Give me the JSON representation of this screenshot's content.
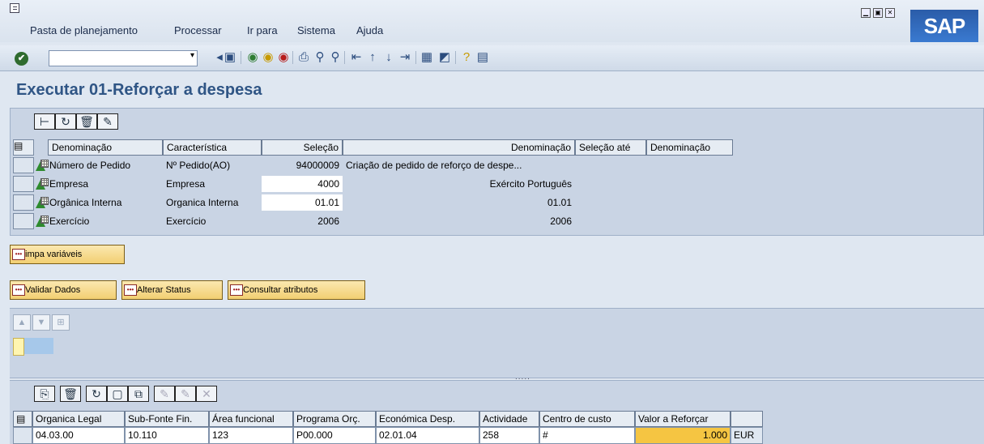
{
  "menubar": {
    "items": [
      "Pasta de planejamento",
      "Processar",
      "Ir para",
      "Sistema",
      "Ajuda"
    ],
    "logo": "SAP"
  },
  "toolbar": {
    "command_field_value": "",
    "icons": [
      "ok-icon",
      "save-icon",
      "back-icon",
      "exit-icon",
      "cancel-icon",
      "print-icon",
      "find-icon",
      "find-next-icon",
      "first-page-icon",
      "previous-page-icon",
      "next-page-icon",
      "last-page-icon",
      "create-session-icon",
      "shortcut-icon",
      "help-icon",
      "layout-icon"
    ]
  },
  "page": {
    "title": "Executar 01-Reforçar a despesa"
  },
  "grid1": {
    "headers": [
      "Denominação",
      "Característica",
      "Seleção",
      "Denominação",
      "Seleção até",
      "Denominação"
    ],
    "rows": [
      {
        "denominacao": "Número de Pedido",
        "caracteristica": "Nº Pedido(AO)",
        "selecao": "94000009",
        "denominacao2": "Criação de pedido de reforço de despe..."
      },
      {
        "denominacao": "Empresa",
        "caracteristica": "Empresa",
        "selecao": "4000",
        "denominacao2": "Exército Português"
      },
      {
        "denominacao": "Orgânica Interna",
        "caracteristica": "Organica Interna",
        "selecao": "01.01",
        "denominacao2": "01.01"
      },
      {
        "denominacao": "Exercício",
        "caracteristica": "Exercício",
        "selecao": "2006",
        "denominacao2": "2006"
      }
    ]
  },
  "buttons": {
    "limpa": "impa variáveis",
    "validar": "Validar Dados",
    "alterar": "Alterar Status",
    "consultar": "Consultar atributos"
  },
  "grid2": {
    "headers": [
      "Organica Legal",
      "Sub-Fonte Fin.",
      "Área funcional",
      "Programa Orç.",
      "Económica Desp.",
      "Actividade",
      "Centro de custo",
      "Valor a Reforçar"
    ],
    "row": [
      "04.03.00",
      "10.110",
      "123",
      "P00.000",
      "02.01.04",
      "258",
      "#",
      "1.000"
    ],
    "currency": "EUR"
  },
  "divider_dots": "....."
}
